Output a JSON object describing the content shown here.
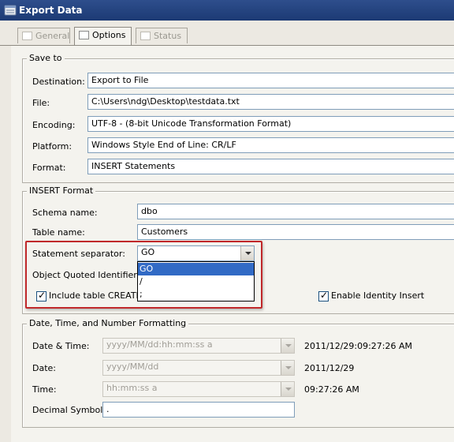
{
  "window": {
    "title": "Export Data"
  },
  "tabs": [
    {
      "label": "General",
      "state": "disabled"
    },
    {
      "label": "Options",
      "state": "active"
    },
    {
      "label": "Status",
      "state": "disabled"
    }
  ],
  "save_to": {
    "legend": "Save to",
    "destination": {
      "label": "Destination:",
      "value": "Export to File"
    },
    "file": {
      "label": "File:",
      "value": "C:\\Users\\ndg\\Desktop\\testdata.txt"
    },
    "encoding": {
      "label": "Encoding:",
      "value": "UTF-8 - (8-bit Unicode Transformation Format)"
    },
    "platform": {
      "label": "Platform:",
      "value": "Windows Style End of Line: CR/LF"
    },
    "format": {
      "label": "Format:",
      "value": "INSERT Statements"
    }
  },
  "insert_format": {
    "legend": "INSERT Format",
    "schema_name": {
      "label": "Schema name:",
      "value": "dbo"
    },
    "table_name": {
      "label": "Table name:",
      "value": "Customers"
    },
    "statement_separator": {
      "label": "Statement separator:",
      "value": "GO",
      "options": [
        "GO",
        "/",
        ";"
      ]
    },
    "object_quoted_identifier": {
      "label": "Object Quoted Identifier:"
    },
    "include_create": {
      "label": "Include table CREATE a",
      "checked": true
    },
    "enable_identity_insert": {
      "label": "Enable Identity Insert",
      "checked": true
    }
  },
  "datetime": {
    "legend": "Date, Time, and Number Formatting",
    "date_time": {
      "label": "Date & Time:",
      "format": "yyyy/MM/dd:hh:mm:ss a",
      "preview": "2011/12/29:09:27:26 AM"
    },
    "date": {
      "label": "Date:",
      "format": "yyyy/MM/dd",
      "preview": "2011/12/29"
    },
    "time": {
      "label": "Time:",
      "format": "hh:mm:ss a",
      "preview": "09:27:26 AM"
    },
    "decimal_symbol": {
      "label": "Decimal Symbol:",
      "value": "."
    }
  },
  "colors": {
    "titlebar": "#1c3a74",
    "selection": "#316ac5",
    "highlight_box": "#c0282a"
  }
}
